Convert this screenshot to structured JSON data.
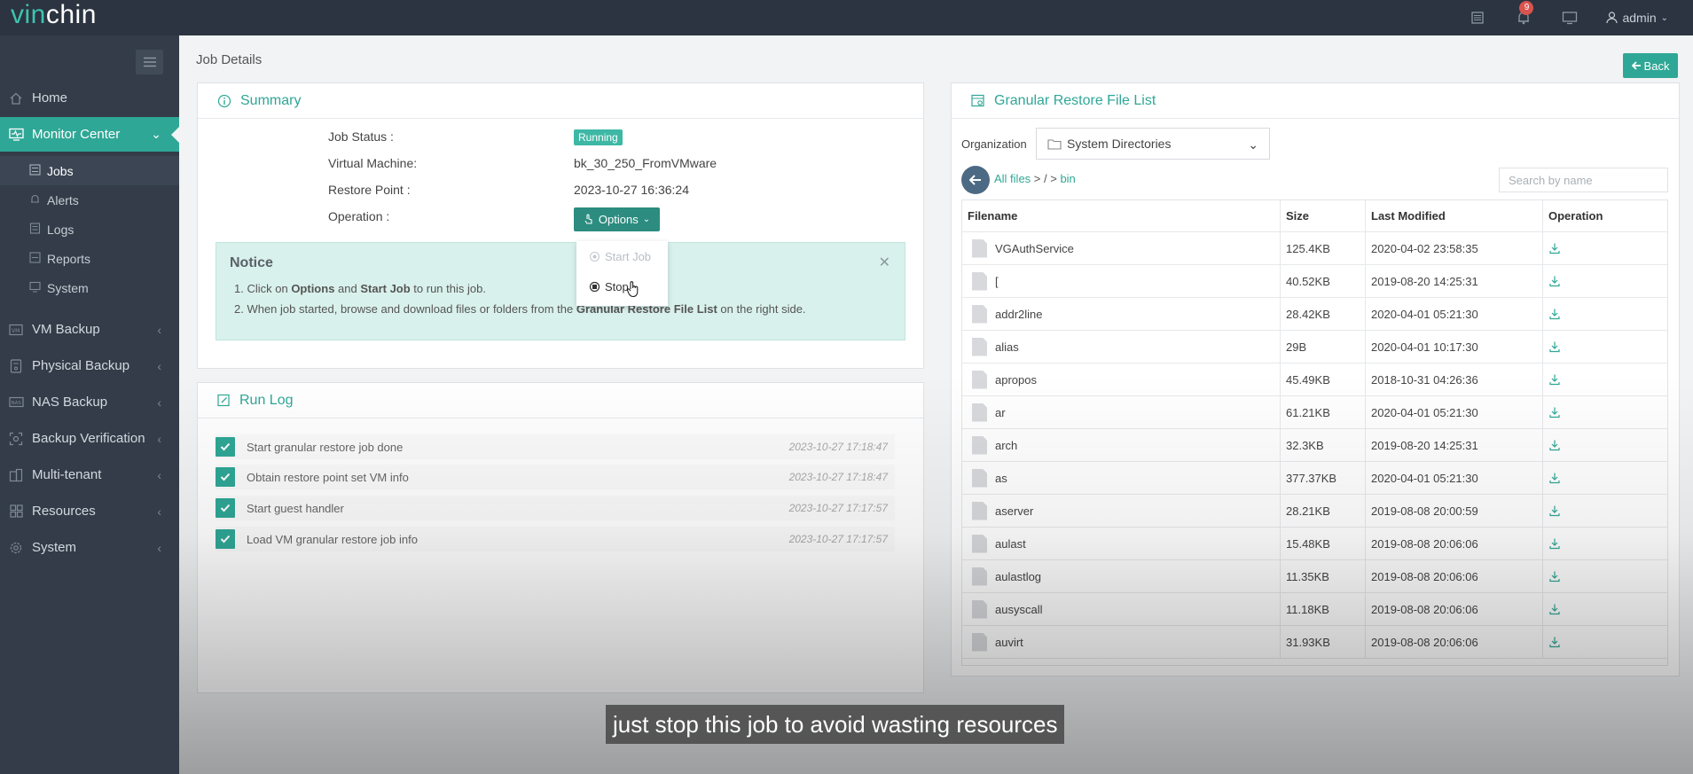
{
  "app": {
    "logo_v": "vin",
    "logo_rest": "chin"
  },
  "topbar": {
    "notification_count": "9",
    "user_label": "admin"
  },
  "sidebar": {
    "items": [
      {
        "label": "Home",
        "icon": "home-icon"
      },
      {
        "label": "Monitor Center",
        "icon": "monitor-icon"
      },
      {
        "label": "VM Backup",
        "icon": "vm-icon"
      },
      {
        "label": "Physical Backup",
        "icon": "disk-icon"
      },
      {
        "label": "NAS Backup",
        "icon": "nas-icon"
      },
      {
        "label": "Backup Verification",
        "icon": "verify-icon"
      },
      {
        "label": "Multi-tenant",
        "icon": "tenant-icon"
      },
      {
        "label": "Resources",
        "icon": "grid-icon"
      },
      {
        "label": "System",
        "icon": "gear-icon"
      }
    ],
    "sub_items": [
      {
        "label": "Jobs"
      },
      {
        "label": "Alerts"
      },
      {
        "label": "Logs"
      },
      {
        "label": "Reports"
      },
      {
        "label": "System"
      }
    ]
  },
  "page": {
    "title": "Job Details",
    "back_label": "Back"
  },
  "summary": {
    "title": "Summary",
    "job_status_label": "Job Status :",
    "job_status": "Running",
    "vm_label": "Virtual Machine:",
    "vm": "bk_30_250_FromVMware",
    "restore_point_label": "Restore Point :",
    "restore_point": "2023-10-27 16:36:24",
    "operation_label": "Operation :",
    "options_label": "Options"
  },
  "dropdown": {
    "start_job": "Start Job",
    "stop": "Stop"
  },
  "notice": {
    "title": "Notice",
    "l1_a": "1. Click on ",
    "l1_b": "Options",
    "l1_c": " and ",
    "l1_d": "Start Job",
    "l1_e": " to run this job.",
    "l2_a": "2. When job started, browse and download files or folders from the ",
    "l2_b": "Granular Restore File List",
    "l2_c": " on the right side."
  },
  "run_log": {
    "title": "Run Log",
    "entries": [
      {
        "text": "Start granular restore job done",
        "time": "2023-10-27 17:18:47"
      },
      {
        "text": "Obtain restore point set VM info",
        "time": "2023-10-27 17:18:47"
      },
      {
        "text": "Start guest handler",
        "time": "2023-10-27 17:17:57"
      },
      {
        "text": "Load VM granular restore job info",
        "time": "2023-10-27 17:17:57"
      }
    ]
  },
  "file_list": {
    "title": "Granular Restore File List",
    "org_label": "Organization",
    "org_value": "System Directories",
    "crumb_all": "All files",
    "crumb_mid": " > / > ",
    "crumb_bin": "bin",
    "search_placeholder": "Search by name",
    "headers": {
      "name": "Filename",
      "size": "Size",
      "modified": "Last Modified",
      "op": "Operation"
    },
    "rows": [
      {
        "name": "VGAuthService",
        "size": "125.4KB",
        "modified": "2020-04-02 23:58:35"
      },
      {
        "name": "[",
        "size": "40.52KB",
        "modified": "2019-08-20 14:25:31"
      },
      {
        "name": "addr2line",
        "size": "28.42KB",
        "modified": "2020-04-01 05:21:30"
      },
      {
        "name": "alias",
        "size": "29B",
        "modified": "2020-04-01 10:17:30"
      },
      {
        "name": "apropos",
        "size": "45.49KB",
        "modified": "2018-10-31 04:26:36"
      },
      {
        "name": "ar",
        "size": "61.21KB",
        "modified": "2020-04-01 05:21:30"
      },
      {
        "name": "arch",
        "size": "32.3KB",
        "modified": "2019-08-20 14:25:31"
      },
      {
        "name": "as",
        "size": "377.37KB",
        "modified": "2020-04-01 05:21:30"
      },
      {
        "name": "aserver",
        "size": "28.21KB",
        "modified": "2019-08-08 20:00:59"
      },
      {
        "name": "aulast",
        "size": "15.48KB",
        "modified": "2019-08-08 20:06:06"
      },
      {
        "name": "aulastlog",
        "size": "11.35KB",
        "modified": "2019-08-08 20:06:06"
      },
      {
        "name": "ausyscall",
        "size": "11.18KB",
        "modified": "2019-08-08 20:06:06"
      },
      {
        "name": "auvirt",
        "size": "31.93KB",
        "modified": "2019-08-08 20:06:06"
      }
    ]
  },
  "subtitle": "just stop this job to avoid wasting resources",
  "colors": {
    "accent": "#2fa796",
    "sidebar": "#333c48",
    "topbar": "#2b3440",
    "badge": "#d9534f"
  }
}
